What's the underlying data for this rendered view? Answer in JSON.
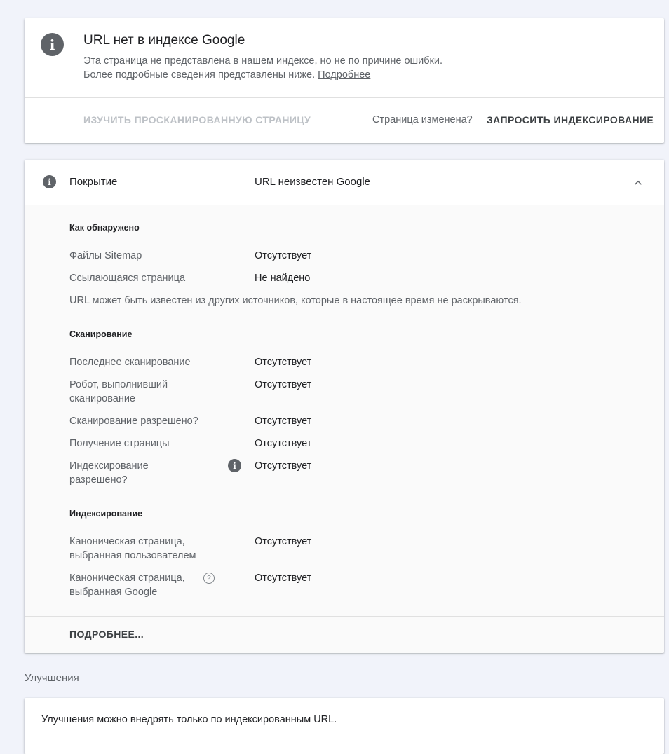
{
  "status": {
    "title": "URL нет в индексе Google",
    "desc_line1": "Эта страница не представлена в нашем индексе, но не по причине ошибки.",
    "desc_line2": "Более подробные сведения представлены ниже.",
    "desc_link": "Подробнее",
    "inspect_button": "ИЗУЧИТЬ ПРОСКАНИРОВАННУЮ СТРАНИЦУ",
    "changed_question": "Страница изменена?",
    "request_button": "ЗАПРОСИТЬ ИНДЕКСИРОВАНИЕ"
  },
  "coverage": {
    "label": "Покрытие",
    "value": "URL неизвестен Google",
    "discovery": {
      "title": "Как обнаружено",
      "rows": [
        {
          "label": "Файлы Sitemap",
          "value": "Отсутствует"
        },
        {
          "label": "Ссылающаяся страница",
          "value": "Не найдено"
        }
      ],
      "note": "URL может быть известен из других источников, которые в настоящее время не раскрываются."
    },
    "crawl": {
      "title": "Сканирование",
      "rows": [
        {
          "label": "Последнее сканирование",
          "value": "Отсутствует"
        },
        {
          "label": "Робот, выполнивший сканирование",
          "value": "Отсутствует"
        },
        {
          "label": "Сканирование разрешено?",
          "value": "Отсутствует"
        },
        {
          "label": "Получение страницы",
          "value": "Отсутствует"
        },
        {
          "label": "Индексирование разрешено?",
          "value": "Отсутствует"
        }
      ]
    },
    "indexing": {
      "title": "Индексирование",
      "rows": [
        {
          "label": "Каноническая страница, выбранная пользователем",
          "value": "Отсутствует"
        },
        {
          "label": "Каноническая страница, выбранная Google",
          "value": "Отсутствует"
        }
      ]
    },
    "more_button": "ПОДРОБНЕЕ..."
  },
  "improvements": {
    "heading": "Улучшения",
    "text": "Улучшения можно внедрять только по индексированным URL."
  },
  "icons": {
    "status_icon": "info-icon",
    "coverage_icon": "info-icon",
    "expand": "chevron-up-icon",
    "help": "help-icon"
  }
}
